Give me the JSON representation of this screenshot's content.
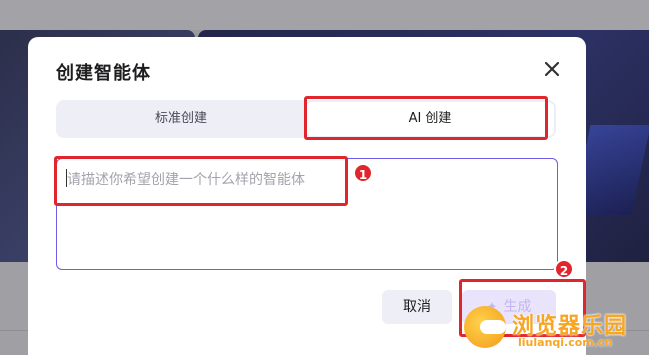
{
  "dialog": {
    "title": "创建智能体",
    "tabs": [
      {
        "label": "标准创建",
        "active": false
      },
      {
        "label": "AI 创建",
        "active": true
      }
    ],
    "prompt_input": {
      "placeholder": "请描述你希望创建一个什么样的智能体",
      "value": ""
    },
    "cancel_label": "取消",
    "generate_label": "生成"
  },
  "annotations": {
    "badge_1": "1",
    "badge_2": "2"
  },
  "watermark": {
    "text": "浏览器乐园",
    "url": "liulanqi.com.cn"
  },
  "colors": {
    "accent": "#6c5ce7",
    "annotation_red": "#e0262c",
    "generate_bg": "#e9e3fb"
  }
}
